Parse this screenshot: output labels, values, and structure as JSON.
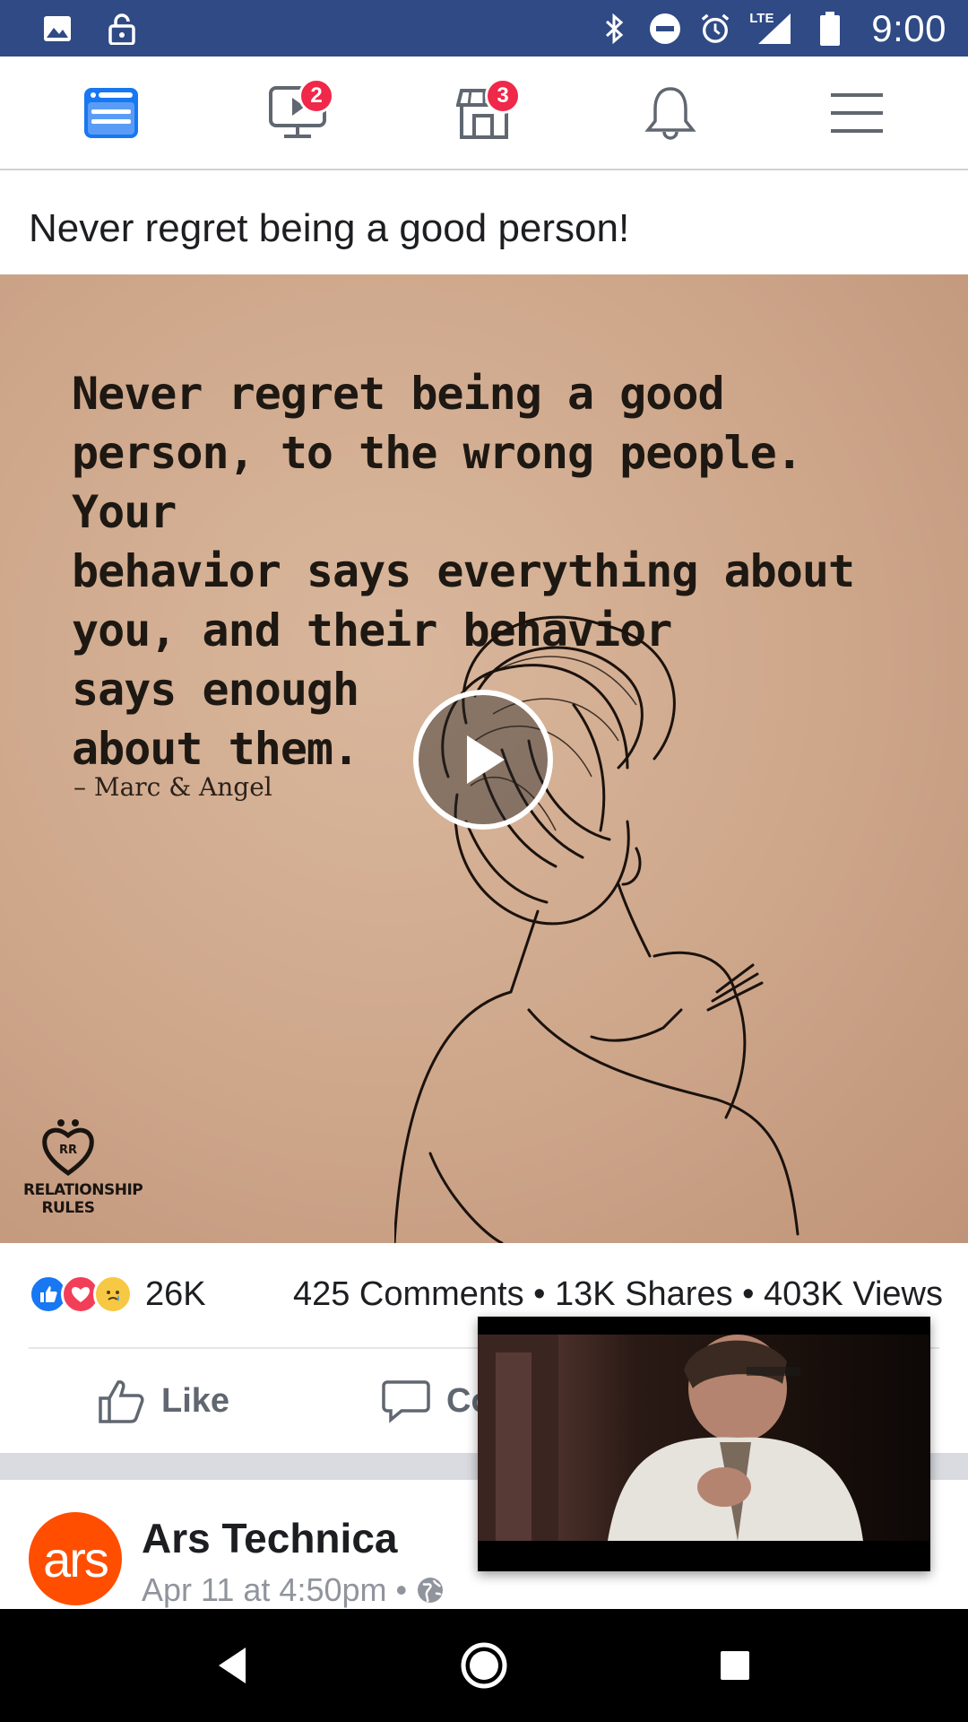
{
  "status_bar": {
    "time": "9:00",
    "network": "LTE"
  },
  "top_nav": {
    "items": [
      {
        "name": "news-feed",
        "badge": ""
      },
      {
        "name": "watch",
        "badge": "2"
      },
      {
        "name": "marketplace",
        "badge": "3"
      },
      {
        "name": "notifications",
        "badge": ""
      },
      {
        "name": "menu",
        "badge": ""
      }
    ],
    "accent_color": "#1877f2"
  },
  "post": {
    "caption": "Never regret being a good person!",
    "image": {
      "quote_lines": [
        "Never regret being a good",
        "person, to the wrong people. Your",
        "behavior says everything about",
        "you, and their behavior",
        "says enough",
        "about them."
      ],
      "author": "– Marc & Angel",
      "brand_monogram": "RR",
      "brand_line1": "RELATIONSHIP",
      "brand_line2": "RULES"
    },
    "reaction_count": "26K",
    "stats": "425 Comments • 13K Shares • 403K Views",
    "actions": {
      "like": "Like",
      "comment": "Co"
    }
  },
  "next_post": {
    "avatar_text": "ars",
    "page_name": "Ars Technica",
    "meta": "Apr 11 at 4:50pm •"
  }
}
